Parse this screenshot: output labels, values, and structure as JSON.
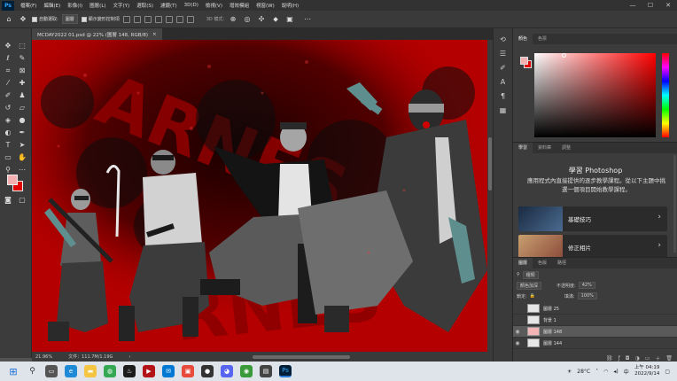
{
  "menubar": {
    "app_abbrev": "Ps",
    "items": [
      "檔案(F)",
      "編輯(E)",
      "影像(I)",
      "圖層(L)",
      "文字(Y)",
      "選取(S)",
      "濾鏡(T)",
      "3D(D)",
      "檢視(V)",
      "增效模組",
      "視窗(W)",
      "說明(H)"
    ],
    "controls": [
      "—",
      "☐",
      "✕"
    ]
  },
  "options": {
    "auto_select_label": "自動選取:",
    "auto_select_value": "圖層",
    "transform_label": "顯示變形控制項",
    "mode3d_label": "3D 模式:"
  },
  "document": {
    "tab_title": "MCDAY2022 01.psd @ 22% (圖層 148, RGB/8)",
    "tab_close": "×",
    "zoom": "21.96%",
    "doc_info": "文件：111.7M/1.19G",
    "status_arrow": "›"
  },
  "color_panel": {
    "tabs": [
      "顏色",
      "色票"
    ]
  },
  "learn_panel": {
    "tabs": [
      "學習",
      "資料庫",
      "調整"
    ],
    "title": "學習 Photoshop",
    "description": "應用程式內直接提供的逐步教學課程。從以下主題中挑選一個項目開始教學課程。",
    "cards": [
      {
        "label": "基礎技巧",
        "arrow": "›"
      },
      {
        "label": "修正相片",
        "arrow": "›"
      }
    ]
  },
  "layers_panel": {
    "tabs": [
      "圖層",
      "色版",
      "路徑"
    ],
    "filter_label": "種類",
    "blend_mode": "顏色加深",
    "opacity_label": "不透明度:",
    "opacity_value": "42%",
    "lock_label": "鎖定:",
    "fill_label": "填滿:",
    "fill_value": "100%",
    "layers": [
      {
        "name": "圖層 25",
        "visible": false,
        "selected": false
      },
      {
        "name": "背景 1",
        "visible": false,
        "selected": false
      },
      {
        "name": "圖層 148",
        "visible": true,
        "selected": true
      },
      {
        "name": "圖層 144",
        "visible": true,
        "selected": false
      }
    ]
  },
  "taskbar": {
    "weather": "28°C",
    "ime": "中",
    "time": "上午 04:19",
    "date": "2022/9/14"
  },
  "colors": {
    "foreground": "#f4b0b0",
    "background": "#e00000",
    "canvas_red": "#b40000"
  }
}
